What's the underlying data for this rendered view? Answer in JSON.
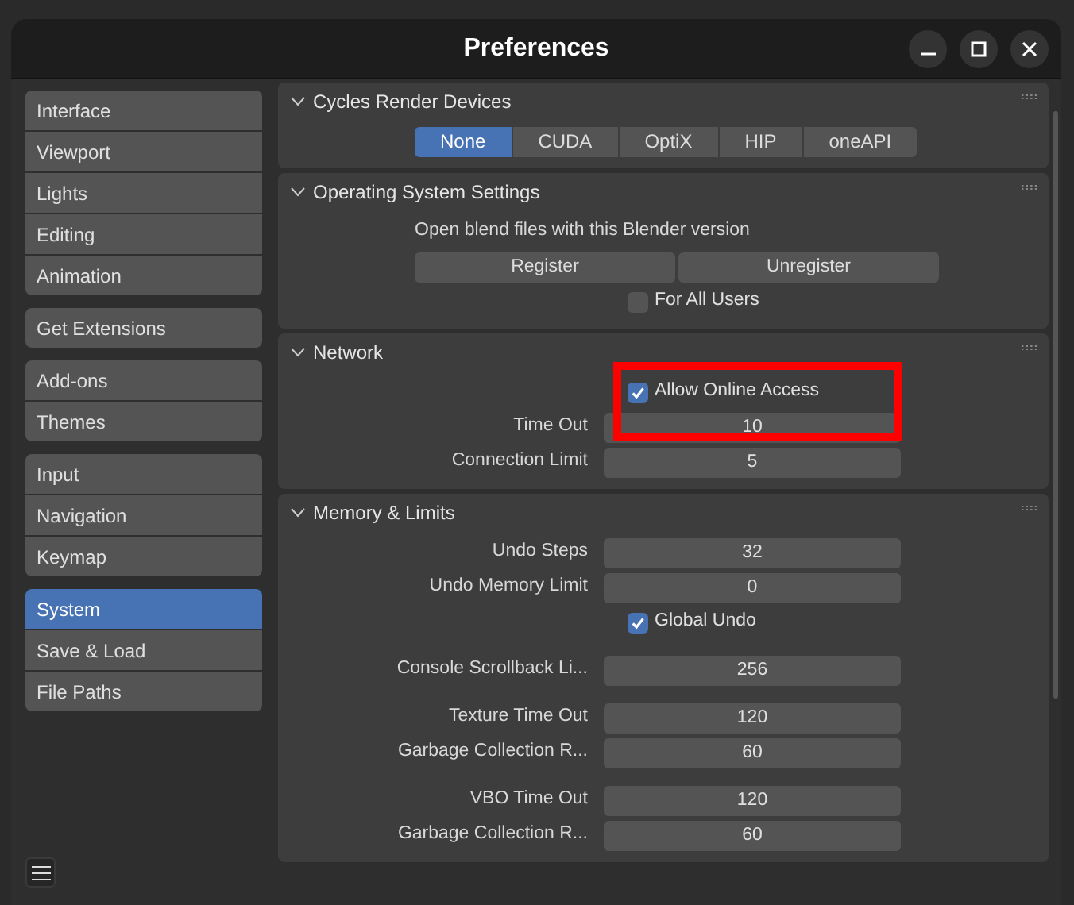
{
  "window": {
    "title": "Preferences"
  },
  "sidebar": {
    "groups": [
      [
        {
          "label": "Interface",
          "selected": false
        },
        {
          "label": "Viewport",
          "selected": false
        },
        {
          "label": "Lights",
          "selected": false
        },
        {
          "label": "Editing",
          "selected": false
        },
        {
          "label": "Animation",
          "selected": false
        }
      ],
      [
        {
          "label": "Get Extensions",
          "selected": false
        }
      ],
      [
        {
          "label": "Add-ons",
          "selected": false
        },
        {
          "label": "Themes",
          "selected": false
        }
      ],
      [
        {
          "label": "Input",
          "selected": false
        },
        {
          "label": "Navigation",
          "selected": false
        },
        {
          "label": "Keymap",
          "selected": false
        }
      ],
      [
        {
          "label": "System",
          "selected": true
        },
        {
          "label": "Save & Load",
          "selected": false
        },
        {
          "label": "File Paths",
          "selected": false
        }
      ]
    ]
  },
  "sections": [
    {
      "title": "Cycles Render Devices",
      "expanded": true,
      "groups": [
        [
          {
            "kind": "toggles",
            "options": [
              {
                "label": "None",
                "selected": true
              },
              {
                "label": "CUDA",
                "selected": false
              },
              {
                "label": "OptiX",
                "selected": false
              },
              {
                "label": "HIP",
                "selected": false
              },
              {
                "label": "oneAPI",
                "selected": false
              }
            ]
          }
        ]
      ]
    },
    {
      "title": "Operating System Settings",
      "expanded": true,
      "groups": [
        [
          {
            "kind": "text",
            "text": "Open blend files with this Blender version"
          },
          {
            "kind": "buttons",
            "buttons": [
              "Register",
              "Unregister"
            ]
          },
          {
            "kind": "checkbox",
            "label": "For All Users",
            "checked": false
          }
        ]
      ]
    },
    {
      "title": "Network",
      "expanded": true,
      "groups": [
        [
          {
            "kind": "checkbox",
            "label": "Allow Online Access",
            "checked": true,
            "highlighted": true
          },
          {
            "kind": "number",
            "label": "Time Out",
            "value": "10"
          },
          {
            "kind": "number",
            "label": "Connection Limit",
            "value": "5"
          }
        ]
      ]
    },
    {
      "title": "Memory & Limits",
      "expanded": true,
      "groups": [
        [
          {
            "kind": "number",
            "label": "Undo Steps",
            "value": "32"
          },
          {
            "kind": "number",
            "label": "Undo Memory Limit",
            "value": "0"
          },
          {
            "kind": "checkbox",
            "label": "Global Undo",
            "checked": true
          }
        ],
        [
          {
            "kind": "number",
            "label": "Console Scrollback Li...",
            "value": "256"
          }
        ],
        [
          {
            "kind": "number",
            "label": "Texture Time Out",
            "value": "120"
          },
          {
            "kind": "number",
            "label": "Garbage Collection R...",
            "value": "60"
          }
        ],
        [
          {
            "kind": "number",
            "label": "VBO Time Out",
            "value": "120"
          },
          {
            "kind": "number",
            "label": "Garbage Collection R...",
            "value": "60"
          }
        ]
      ]
    }
  ]
}
